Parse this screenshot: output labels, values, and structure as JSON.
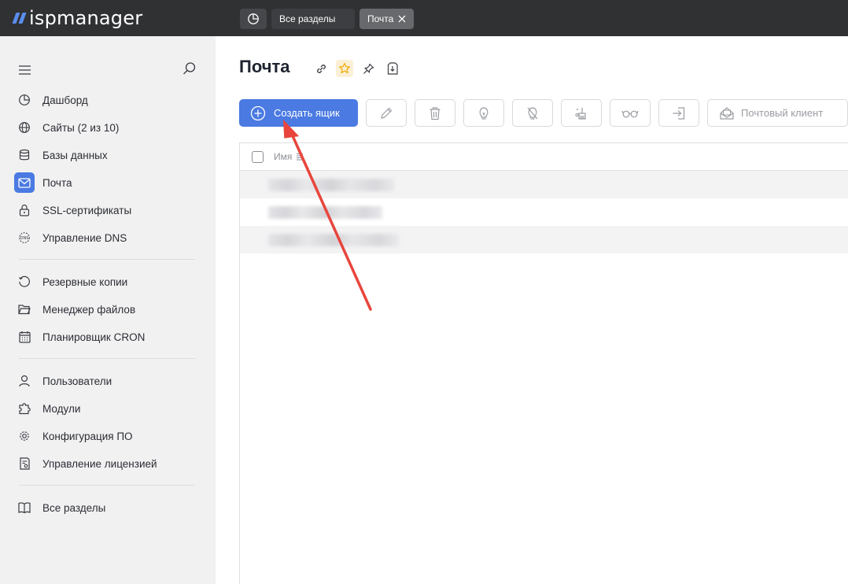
{
  "app": {
    "logo_text": "ispmanager",
    "brand_color": "#4a7ae2"
  },
  "topbar": {
    "tabs": [
      {
        "label": "Все разделы"
      },
      {
        "label": "Почта"
      }
    ]
  },
  "sidebar": {
    "items": [
      {
        "label": "Дашборд",
        "icon": "dashboard-icon"
      },
      {
        "label": "Сайты (2 из 10)",
        "icon": "globe-icon"
      },
      {
        "label": "Базы данных",
        "icon": "database-icon"
      },
      {
        "label": "Почта",
        "icon": "mail-icon",
        "active": true
      },
      {
        "label": "SSL-сертификаты",
        "icon": "lock-icon"
      },
      {
        "label": "Управление DNS",
        "icon": "dns-icon"
      },
      {
        "label": "Резервные копии",
        "icon": "backup-icon"
      },
      {
        "label": "Менеджер файлов",
        "icon": "folder-icon"
      },
      {
        "label": "Планировщик CRON",
        "icon": "calendar-icon"
      },
      {
        "label": "Пользователи",
        "icon": "user-icon"
      },
      {
        "label": "Модули",
        "icon": "puzzle-icon"
      },
      {
        "label": "Конфигурация ПО",
        "icon": "gear-icon"
      },
      {
        "label": "Управление лицензией",
        "icon": "license-icon"
      },
      {
        "label": "Все разделы",
        "icon": "book-icon"
      }
    ]
  },
  "main": {
    "title": "Почта",
    "toolbar": {
      "create_label": "Создать ящик",
      "client_label": "Почтовый клиент"
    },
    "table": {
      "columns": [
        "Имя"
      ],
      "rows": [
        {
          "name": ""
        },
        {
          "name": ""
        },
        {
          "name": ""
        }
      ]
    }
  },
  "annotation": {
    "arrow_color": "#e8453c"
  }
}
